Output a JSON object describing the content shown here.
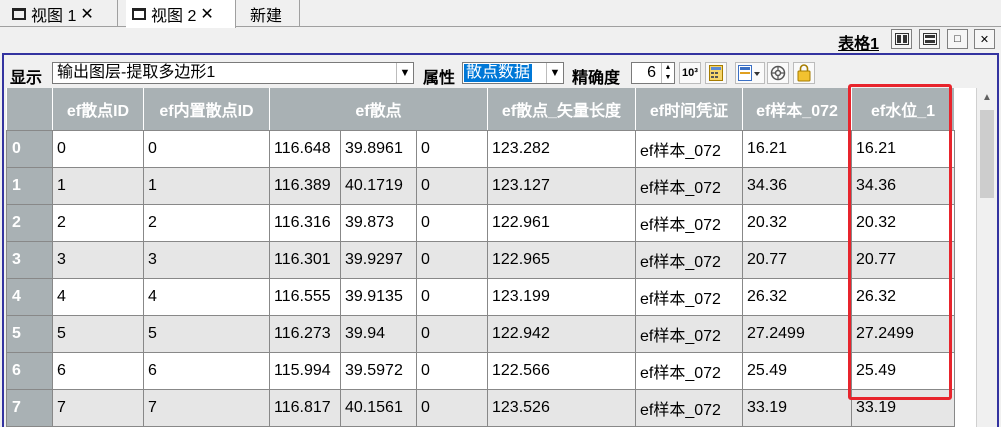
{
  "tabs": [
    {
      "label": "视图 1",
      "close": "✕",
      "icon": "window-icon"
    },
    {
      "label": "视图 2",
      "close": "✕",
      "icon": "window-icon"
    },
    {
      "label": "新建"
    }
  ],
  "panel": {
    "title": "表格1",
    "buttons": [
      "layout-columns-icon",
      "layout-rows-icon",
      "maximize-icon",
      "close-icon"
    ],
    "close_glyph": "✕",
    "restore_glyph": "□"
  },
  "toolbar": {
    "display_label": "显示",
    "layer_value": "输出图层-提取多边形1",
    "attr_label": "属性",
    "attr_value": "散点数据",
    "precision_label": "精确度",
    "precision_value": "6",
    "icons": [
      "scientific-notation-icon",
      "calculator-icon",
      "column-chooser-icon",
      "settings-wheel-icon",
      "lock-icon"
    ],
    "sci_text": "10³"
  },
  "table": {
    "headers": [
      "ef散点ID",
      "ef内置散点ID",
      "ef散点",
      "ef散点_矢量长度",
      "ef时间凭证",
      "ef样本_072",
      "ef水位_1"
    ],
    "rows": [
      {
        "idx": "0",
        "id": "0",
        "inner": "0",
        "lon": "116.648",
        "lat": "39.8961",
        "z": "0",
        "len": "123.282",
        "time": "ef样本_072",
        "sample": "16.21",
        "water": "16.21"
      },
      {
        "idx": "1",
        "id": "1",
        "inner": "1",
        "lon": "116.389",
        "lat": "40.1719",
        "z": "0",
        "len": "123.127",
        "time": "ef样本_072",
        "sample": "34.36",
        "water": "34.36"
      },
      {
        "idx": "2",
        "id": "2",
        "inner": "2",
        "lon": "116.316",
        "lat": "39.873",
        "z": "0",
        "len": "122.961",
        "time": "ef样本_072",
        "sample": "20.32",
        "water": "20.32"
      },
      {
        "idx": "3",
        "id": "3",
        "inner": "3",
        "lon": "116.301",
        "lat": "39.9297",
        "z": "0",
        "len": "122.965",
        "time": "ef样本_072",
        "sample": "20.77",
        "water": "20.77"
      },
      {
        "idx": "4",
        "id": "4",
        "inner": "4",
        "lon": "116.555",
        "lat": "39.9135",
        "z": "0",
        "len": "123.199",
        "time": "ef样本_072",
        "sample": "26.32",
        "water": "26.32"
      },
      {
        "idx": "5",
        "id": "5",
        "inner": "5",
        "lon": "116.273",
        "lat": "39.94",
        "z": "0",
        "len": "122.942",
        "time": "ef样本_072",
        "sample": "27.2499",
        "water": "27.2499"
      },
      {
        "idx": "6",
        "id": "6",
        "inner": "6",
        "lon": "115.994",
        "lat": "39.5972",
        "z": "0",
        "len": "122.566",
        "time": "ef样本_072",
        "sample": "25.49",
        "water": "25.49"
      },
      {
        "idx": "7",
        "id": "7",
        "inner": "7",
        "lon": "116.817",
        "lat": "40.1561",
        "z": "0",
        "len": "123.526",
        "time": "ef样本_072",
        "sample": "33.19",
        "water": "33.19"
      }
    ]
  },
  "colors": {
    "header_bg": "#a9b1b4",
    "alt_row_bg": "#e6e6e6",
    "highlight": "#e8242c",
    "selection": "#0078d7",
    "panel_border": "#3333a0"
  }
}
